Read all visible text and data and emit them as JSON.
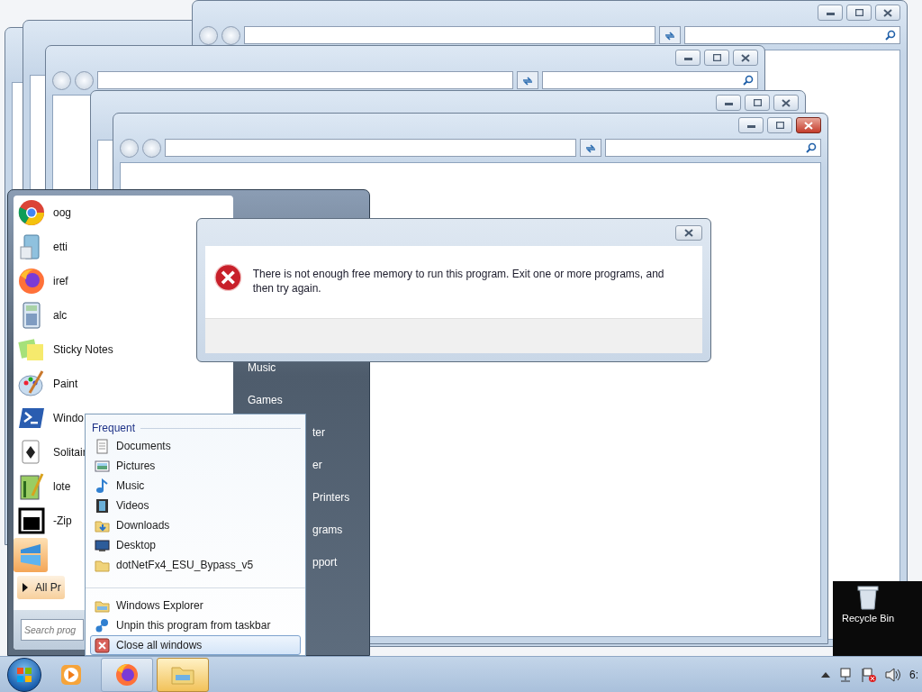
{
  "explorer_windows": [
    {
      "active": false
    },
    {
      "active": false
    },
    {
      "active": false
    },
    {
      "active": true
    }
  ],
  "desktop_icons": [
    {
      "label": "Recycle Bin"
    }
  ],
  "start_menu": {
    "programs": [
      {
        "label": "oog",
        "selected": false
      },
      {
        "label": "etti",
        "selected": false
      },
      {
        "label": "iref",
        "selected": false
      },
      {
        "label": "alc",
        "selected": false
      },
      {
        "label": "Sticky Notes",
        "selected": false
      },
      {
        "label": "Paint",
        "selected": false
      },
      {
        "label": "Windo",
        "selected": false
      },
      {
        "label": "Solitair",
        "selected": false
      },
      {
        "label": "lote",
        "selected": false
      },
      {
        "label": "-Zip",
        "selected": false
      },
      {
        "selected": true
      }
    ],
    "all_programs": "All Pr",
    "search": {
      "placeholder": "Search prog"
    },
    "places": [
      {
        "label": "Music"
      },
      {
        "label": "Games"
      },
      {
        "label": "ter"
      },
      {
        "label": "er"
      },
      {
        "label": "Printers"
      },
      {
        "label": "grams"
      },
      {
        "label": "pport"
      }
    ]
  },
  "dialog": {
    "message": "There is not enough free memory to run this program. Exit one or more programs, and then try again."
  },
  "jump_list": {
    "heading": "Frequent",
    "frequent": [
      {
        "label": "Documents"
      },
      {
        "label": "Pictures"
      },
      {
        "label": "Music"
      },
      {
        "label": "Videos"
      },
      {
        "label": "Downloads"
      },
      {
        "label": "Desktop"
      },
      {
        "label": "dotNetFx4_ESU_Bypass_v5"
      }
    ],
    "tasks": [
      {
        "label": "Windows Explorer",
        "selected": false
      },
      {
        "label": "Unpin this program from taskbar",
        "selected": false
      },
      {
        "label": "Close all windows",
        "selected": true
      }
    ]
  },
  "taskbar": {
    "buttons": [
      {
        "running": false,
        "selected": false
      },
      {
        "running": true,
        "selected": false
      },
      {
        "running": true,
        "selected": true
      }
    ],
    "clock": "6:"
  }
}
